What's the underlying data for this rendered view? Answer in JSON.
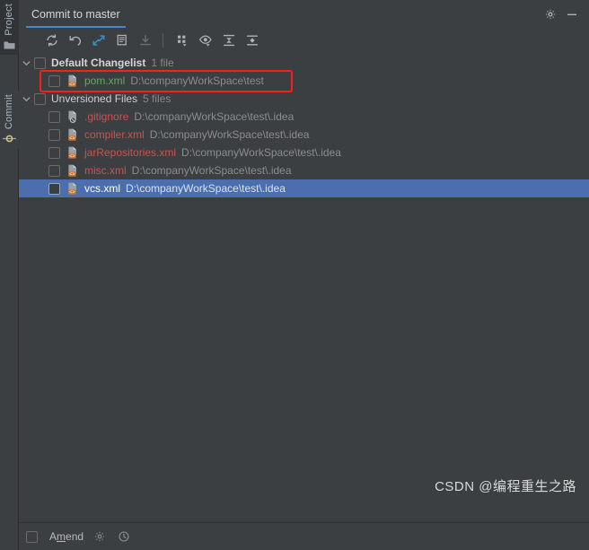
{
  "window": {
    "title": "Commit to master",
    "settings_icon": "gear-icon",
    "minimize_icon": "minimize-icon"
  },
  "rail": {
    "items": [
      {
        "label": "Project",
        "icon": "folder-icon"
      },
      {
        "label": "Commit",
        "icon": "commit-node-icon"
      }
    ]
  },
  "tabs": [
    {
      "label": "Commit to master",
      "active": true
    }
  ],
  "toolbar": {
    "buttons": [
      {
        "name": "refresh-changes-button",
        "icon": "refresh-icon",
        "disabled": false
      },
      {
        "name": "rollback-button",
        "icon": "rollback-icon",
        "disabled": false
      },
      {
        "name": "show-diff-button",
        "icon": "diff-arrows-icon",
        "disabled": false
      },
      {
        "name": "show-commit-options-button",
        "icon": "document-icon",
        "disabled": false
      },
      {
        "name": "update-project-button",
        "icon": "download-icon",
        "disabled": true
      },
      {
        "name": "group-by-button",
        "icon": "group-by-icon",
        "disabled": false
      },
      {
        "name": "preview-diff-button",
        "icon": "eye-icon",
        "disabled": false
      },
      {
        "name": "expand-all-button",
        "icon": "expand-all-icon",
        "disabled": false
      },
      {
        "name": "collapse-all-button",
        "icon": "collapse-all-icon",
        "disabled": false
      }
    ]
  },
  "changelist": {
    "groups": [
      {
        "name": "Default Changelist",
        "count_label": "1 file",
        "bold": true,
        "expanded": true,
        "files": [
          {
            "name": "pom.xml",
            "path": "D:\\companyWorkSpace\\test",
            "status": "added",
            "icon": "xml-file-icon",
            "checked": false,
            "selected": false,
            "highlighted": true
          }
        ]
      },
      {
        "name": "Unversioned Files",
        "count_label": "5 files",
        "bold": false,
        "expanded": true,
        "files": [
          {
            "name": ".gitignore",
            "path": "D:\\companyWorkSpace\\test\\.idea",
            "status": "unversioned",
            "icon": "ignored-file-icon",
            "checked": false,
            "selected": false,
            "highlighted": false
          },
          {
            "name": "compiler.xml",
            "path": "D:\\companyWorkSpace\\test\\.idea",
            "status": "unversioned",
            "icon": "xml-file-icon",
            "checked": false,
            "selected": false,
            "highlighted": false
          },
          {
            "name": "jarRepositories.xml",
            "path": "D:\\companyWorkSpace\\test\\.idea",
            "status": "unversioned",
            "icon": "xml-file-icon",
            "checked": false,
            "selected": false,
            "highlighted": false
          },
          {
            "name": "misc.xml",
            "path": "D:\\companyWorkSpace\\test\\.idea",
            "status": "unversioned",
            "icon": "xml-file-icon",
            "checked": false,
            "selected": false,
            "highlighted": false
          },
          {
            "name": "vcs.xml",
            "path": "D:\\companyWorkSpace\\test\\.idea",
            "status": "unversioned",
            "icon": "xml-file-icon",
            "checked": false,
            "selected": true,
            "highlighted": false
          }
        ]
      }
    ]
  },
  "bottom_bar": {
    "amend_label_prefix": "A",
    "amend_label_accel": "m",
    "amend_label_suffix": "end",
    "amend_checked": false,
    "settings_icon": "gear-icon",
    "history_icon": "clock-icon"
  },
  "watermark": "CSDN @编程重生之路",
  "colors": {
    "background": "#3c3f41",
    "panel_dark": "#313335",
    "selection": "#4b6eaf",
    "tab_underline": "#4a88c7",
    "added_file": "#62a964",
    "unversioned_file": "#c75450",
    "annotation": "#f5211f",
    "icon_blue": "#3592c4",
    "icon_grey": "#afb1b3",
    "xml_badge": "#cc7832"
  }
}
